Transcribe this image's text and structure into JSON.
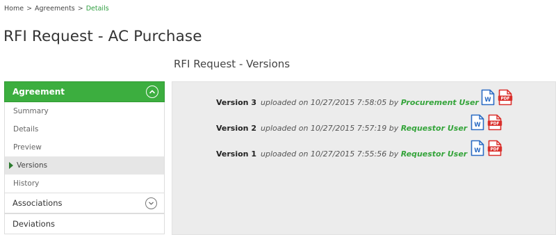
{
  "breadcrumb": {
    "items": [
      "Home",
      "Agreements",
      "Details"
    ],
    "separator": ">"
  },
  "page_title": "RFI Request - AC Purchase",
  "section_title": "RFI Request - Versions",
  "sidebar": {
    "agreement": {
      "label": "Agreement",
      "icon": "chevron-up-circle-icon",
      "items": [
        {
          "label": "Summary",
          "active": false
        },
        {
          "label": "Details",
          "active": false
        },
        {
          "label": "Preview",
          "active": false
        },
        {
          "label": "Versions",
          "active": true
        },
        {
          "label": "History",
          "active": false
        }
      ]
    },
    "associations": {
      "label": "Associations",
      "icon": "chevron-down-circle-icon"
    },
    "deviations": {
      "label": "Deviations"
    }
  },
  "versions": [
    {
      "label": "Version 3",
      "text": "uploaded on 10/27/2015 7:58:05 by",
      "user": "Procurement User",
      "icons": [
        "word-doc-icon",
        "pdf-doc-icon"
      ]
    },
    {
      "label": "Version 2",
      "text": "uploaded on 10/27/2015 7:57:19 by",
      "user": "Requestor User",
      "icons": [
        "word-doc-icon",
        "pdf-doc-icon"
      ]
    },
    {
      "label": "Version 1",
      "text": "uploaded on 10/27/2015 7:55:56 by",
      "user": "Requestor User",
      "icons": [
        "word-doc-icon",
        "pdf-doc-icon"
      ]
    }
  ],
  "colors": {
    "accent_green": "#3cae3f",
    "user_green": "#34a43a",
    "word_blue": "#2b6cc4",
    "pdf_red": "#d9302c"
  },
  "icon_labels": {
    "word": "W",
    "pdf": "PDF"
  }
}
